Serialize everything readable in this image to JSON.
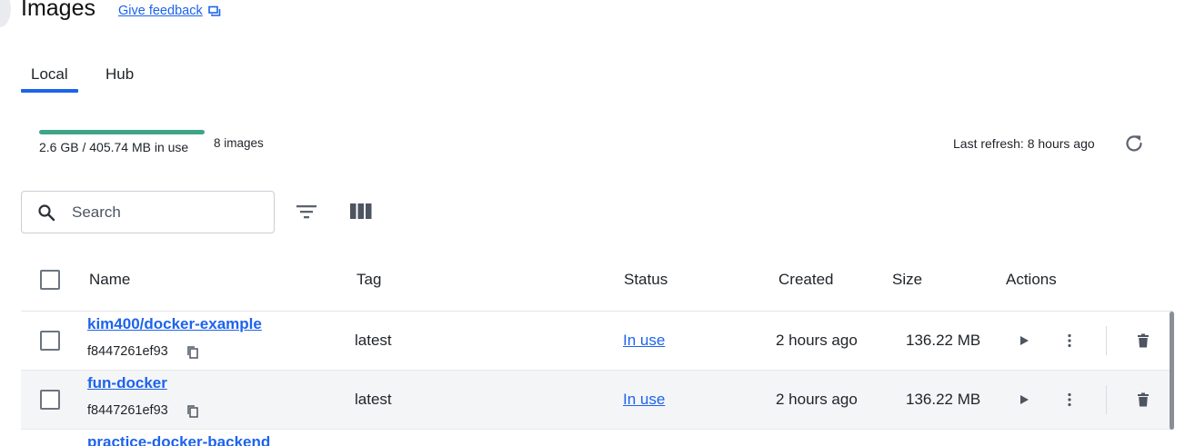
{
  "header": {
    "title": "Images",
    "feedback_label": "Give feedback"
  },
  "tabs": [
    {
      "label": "Local",
      "active": true
    },
    {
      "label": "Hub",
      "active": false
    }
  ],
  "usage": {
    "text": "2.6 GB / 405.74 MB in use",
    "image_count": "8 images",
    "bar_color": "#3fa58a"
  },
  "refresh": {
    "text": "Last refresh: 8 hours ago",
    "icon": "refresh-icon"
  },
  "toolbar": {
    "search_placeholder": "Search",
    "search_value": "",
    "filter_icon": "filter-icon",
    "columns_icon": "columns-icon"
  },
  "table": {
    "columns": [
      "Name",
      "Tag",
      "Status",
      "Created",
      "Size",
      "Actions"
    ],
    "rows": [
      {
        "name": "kim400/docker-example",
        "id": "f8447261ef93",
        "tag": "latest",
        "status": "In use",
        "created": "2 hours ago",
        "size": "136.22 MB"
      },
      {
        "name": "fun-docker",
        "id": "f8447261ef93",
        "tag": "latest",
        "status": "In use",
        "created": "2 hours ago",
        "size": "136.22 MB"
      },
      {
        "name": "practice-docker-backend"
      }
    ]
  },
  "colors": {
    "accent": "#1d63ed",
    "usage_bar": "#3fa58a"
  }
}
